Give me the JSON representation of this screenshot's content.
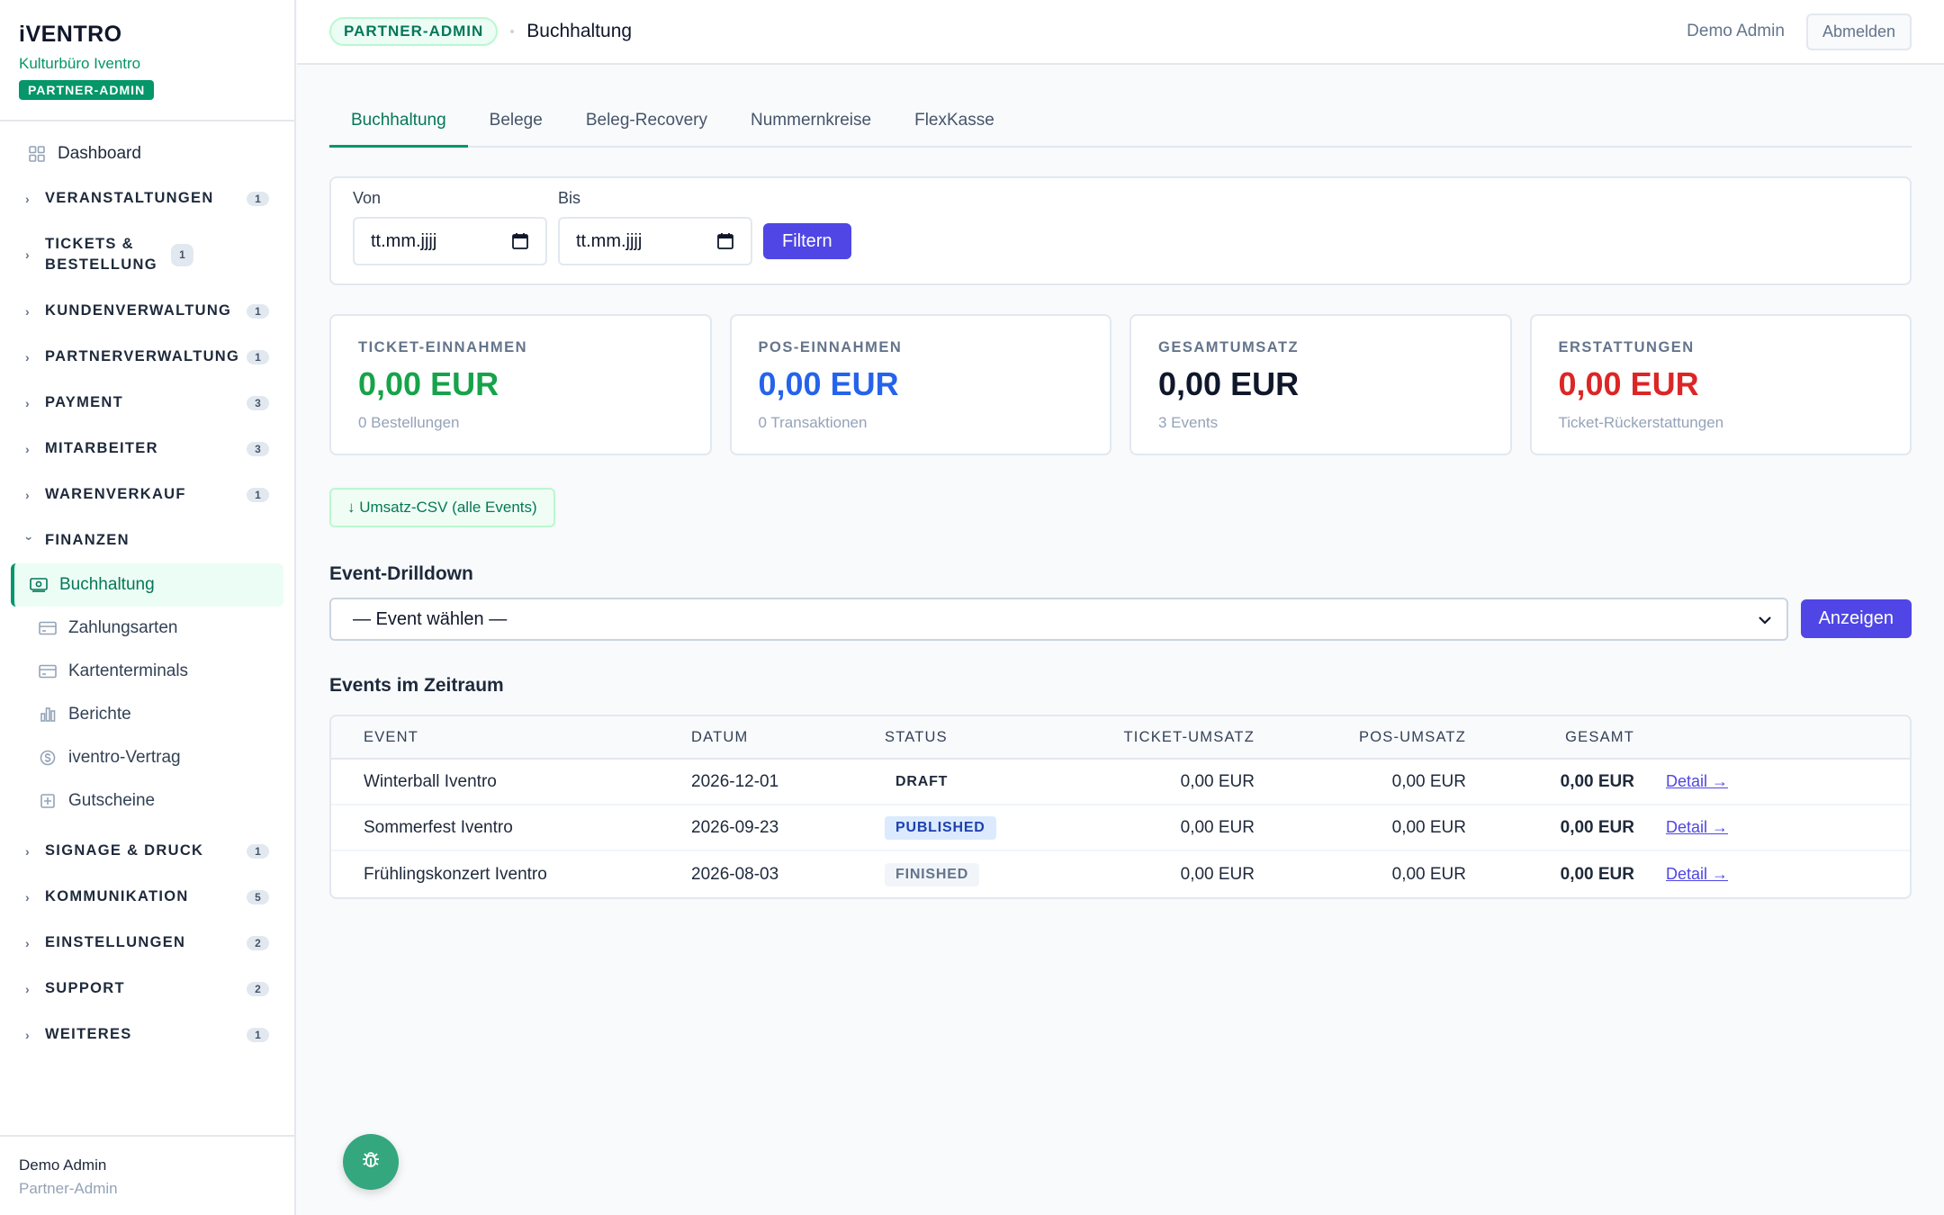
{
  "brand": {
    "logo": "iVENTRO",
    "org": "Kulturbüro Iventro",
    "badge": "PARTNER-ADMIN"
  },
  "sidebar": {
    "dashboard": "Dashboard",
    "groups": [
      {
        "label": "VERANSTALTUNGEN",
        "count": "1"
      },
      {
        "label": "TICKETS & BESTELLUNG",
        "count": "1"
      },
      {
        "label": "KUNDENVERWALTUNG",
        "count": "1"
      },
      {
        "label": "PARTNERVERWALTUNG",
        "count": "1"
      },
      {
        "label": "PAYMENT",
        "count": "3"
      },
      {
        "label": "MITARBEITER",
        "count": "3"
      },
      {
        "label": "WARENVERKAUF",
        "count": "1"
      },
      {
        "label": "FINANZEN"
      },
      {
        "label": "SIGNAGE & DRUCK",
        "count": "1"
      },
      {
        "label": "KOMMUNIKATION",
        "count": "5"
      },
      {
        "label": "EINSTELLUNGEN",
        "count": "2"
      },
      {
        "label": "SUPPORT",
        "count": "2"
      },
      {
        "label": "WEITERES",
        "count": "1"
      }
    ],
    "finance_items": [
      {
        "label": "Buchhaltung",
        "icon": "cash-icon"
      },
      {
        "label": "Zahlungsarten",
        "icon": "card-icon"
      },
      {
        "label": "Kartenterminals",
        "icon": "card-icon"
      },
      {
        "label": "Berichte",
        "icon": "chart-icon"
      },
      {
        "label": "iventro-Vertrag",
        "icon": "dollar-icon"
      },
      {
        "label": "Gutscheine",
        "icon": "gift-icon"
      }
    ],
    "footer": {
      "name": "Demo Admin",
      "role": "Partner-Admin"
    }
  },
  "header": {
    "badge": "PARTNER-ADMIN",
    "title": "Buchhaltung",
    "user": "Demo Admin",
    "logout": "Abmelden"
  },
  "tabs": [
    "Buchhaltung",
    "Belege",
    "Beleg-Recovery",
    "Nummernkreise",
    "FlexKasse"
  ],
  "filter": {
    "from_label": "Von",
    "from_value": "tt.mm.jjjj",
    "to_label": "Bis",
    "to_value": "tt.mm.jjjj",
    "button": "Filtern"
  },
  "stats": [
    {
      "label": "TICKET-EINNAHMEN",
      "value": "0,00 EUR",
      "sub": "0 Bestellungen",
      "color": "#16a34a"
    },
    {
      "label": "POS-EINNAHMEN",
      "value": "0,00 EUR",
      "sub": "0 Transaktionen",
      "color": "#2563eb"
    },
    {
      "label": "GESAMTUMSATZ",
      "value": "0,00 EUR",
      "sub": "3 Events",
      "color": "#0f172a"
    },
    {
      "label": "ERSTATTUNGEN",
      "value": "0,00 EUR",
      "sub": "Ticket-Rückerstattungen",
      "color": "#dc2626"
    }
  ],
  "csv_button": "↓ Umsatz-CSV (alle Events)",
  "drilldown": {
    "title": "Event-Drilldown",
    "select_value": "— Event wählen —",
    "button": "Anzeigen"
  },
  "events": {
    "title": "Events im Zeitraum",
    "columns": [
      "EVENT",
      "DATUM",
      "STATUS",
      "TICKET-UMSATZ",
      "POS-UMSATZ",
      "GESAMT"
    ],
    "rows": [
      {
        "event": "Winterball Iventro",
        "date": "2026-12-01",
        "status": "DRAFT",
        "ticket": "0,00 EUR",
        "pos": "0,00 EUR",
        "total": "0,00 EUR",
        "detail": "Detail →"
      },
      {
        "event": "Sommerfest Iventro",
        "date": "2026-09-23",
        "status": "PUBLISHED",
        "ticket": "0,00 EUR",
        "pos": "0,00 EUR",
        "total": "0,00 EUR",
        "detail": "Detail →"
      },
      {
        "event": "Frühlingskonzert Iventro",
        "date": "2026-08-03",
        "status": "FINISHED",
        "ticket": "0,00 EUR",
        "pos": "0,00 EUR",
        "total": "0,00 EUR",
        "detail": "Detail →"
      }
    ]
  },
  "fab_icon": "bug-icon"
}
